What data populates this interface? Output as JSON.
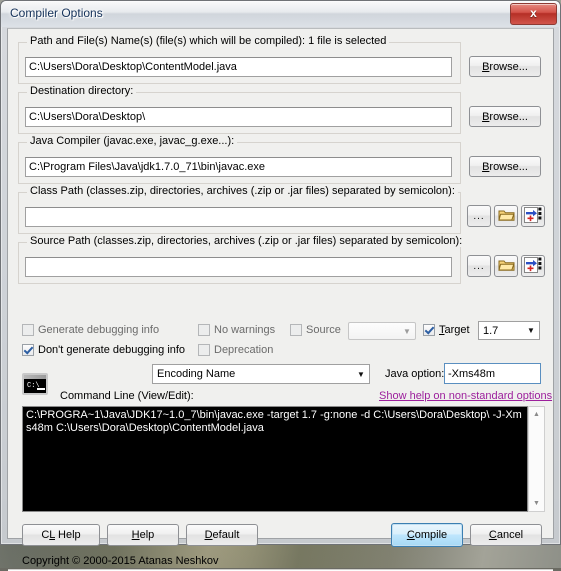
{
  "window": {
    "title": "Compiler Options",
    "close_label": "x"
  },
  "groups": {
    "path_files": {
      "legend": "Path and File(s) Name(s) (file(s) which will be compiled):   1 file is selected",
      "value": "C:\\Users\\Dora\\Desktop\\ContentModel.java",
      "browse_label": "Browse..."
    },
    "destination": {
      "legend": "Destination directory:",
      "value": "C:\\Users\\Dora\\Desktop\\",
      "browse_label": "Browse..."
    },
    "java_compiler": {
      "legend": "Java Compiler (javac.exe,  javac_g.exe...):",
      "value": "C:\\Program Files\\Java\\jdk1.7.0_71\\bin\\javac.exe",
      "browse_label": "Browse..."
    },
    "class_path": {
      "legend": "Class Path (classes.zip, directories, archives (.zip or .jar files) separated by semicolon):",
      "value": "",
      "buttons": [
        {
          "name": "ellipsis-button",
          "label": "..."
        },
        {
          "name": "open-folder-button",
          "label": ""
        },
        {
          "name": "add-path-button",
          "label": ""
        }
      ]
    },
    "source_path": {
      "legend": "Source Path (classes.zip, directories, archives (.zip or .jar files) separated by semicolon):",
      "value": "",
      "buttons": [
        {
          "name": "ellipsis-button",
          "label": "..."
        },
        {
          "name": "open-folder-button",
          "label": ""
        },
        {
          "name": "add-path-button",
          "label": ""
        }
      ]
    }
  },
  "options": {
    "generate_debugging_info": {
      "label": "Generate debugging info",
      "checked": false,
      "accel": "G"
    },
    "dont_generate_debugging_info": {
      "label": "Don't generate debugging info",
      "checked": true
    },
    "no_warnings": {
      "label": "No warnings",
      "checked": false,
      "accel": "r"
    },
    "deprecation": {
      "label": "Deprecation",
      "checked": false,
      "accel": "e"
    },
    "source": {
      "label": "Source",
      "checked": false
    },
    "target": {
      "label": "Target",
      "checked": true,
      "accel": "T"
    },
    "source_version": {
      "value": "",
      "enabled": false
    },
    "target_version": {
      "value": "1.7",
      "enabled": true
    }
  },
  "encoding": {
    "value": "Encoding Name"
  },
  "java_option": {
    "label": "Java option:",
    "value": "-Xms48m"
  },
  "help_link": {
    "label": "Show help on non-standard options"
  },
  "command_line": {
    "label": "Command Line (View/Edit):",
    "icon": "console-icon",
    "text": "C:\\PROGRA~1\\Java\\JDK17~1.0_7\\bin\\javac.exe -target 1.7 -g:none -d C:\\Users\\Dora\\Desktop\\ -J-Xms48m C:\\Users\\Dora\\Desktop\\ContentModel.java"
  },
  "footer": {
    "buttons": {
      "cl_help": "CL Help",
      "help": "Help",
      "default": "Default",
      "compile": "Compile",
      "cancel": "Cancel"
    },
    "copyright": "Copyright © 2000-2015 Atanas Neshkov"
  }
}
